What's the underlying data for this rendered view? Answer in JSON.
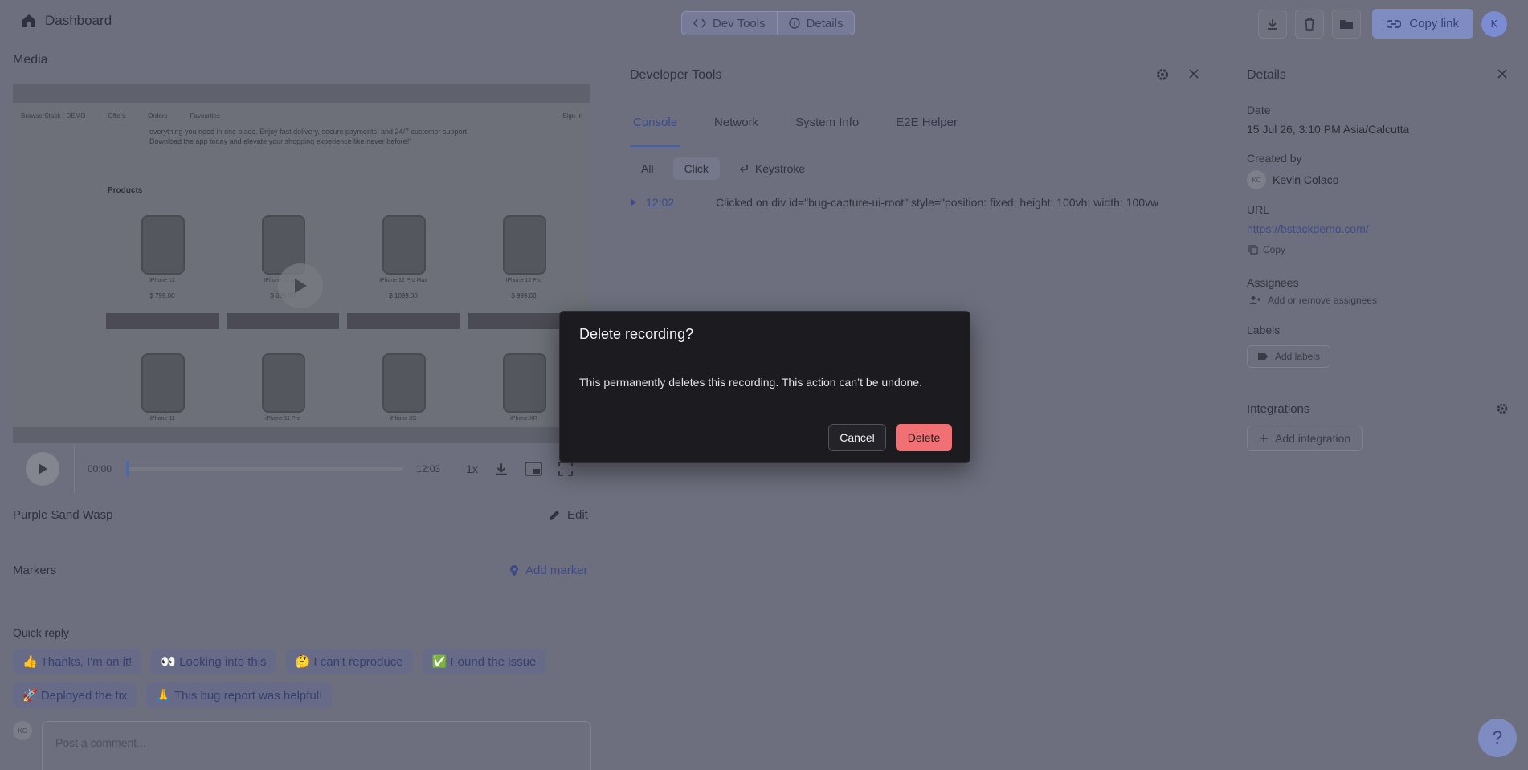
{
  "topbar": {
    "dashboard_label": "Dashboard",
    "tabs": [
      {
        "label": "Dev Tools"
      },
      {
        "label": "Details"
      }
    ],
    "copy_link_label": "Copy link",
    "avatar_initial": "K"
  },
  "media": {
    "title": "Media",
    "site": {
      "brand": "BrowserStack · DEMO",
      "nav": [
        "Offers",
        "Orders",
        "Favourites"
      ],
      "sign_in": "Sign In",
      "description": "everything you need in one place. Enjoy fast delivery, secure payments, and 24/7 customer support. Download the app today and elevate your shopping experience like never before!\"",
      "products_heading": "Products",
      "phones": [
        {
          "name": "iPhone 12",
          "price": "$ 799.00"
        },
        {
          "name": "iPhone 12 Mini",
          "price": "$ 699.00"
        },
        {
          "name": "iPhone 12 Pro Max",
          "price": "$ 1099.00"
        },
        {
          "name": "iPhone 12 Pro",
          "price": "$ 999.00"
        },
        {
          "name": "iPhone 11",
          "price": ""
        },
        {
          "name": "iPhone 11 Pro",
          "price": ""
        },
        {
          "name": "iPhone XS",
          "price": ""
        },
        {
          "name": "iPhone XR",
          "price": ""
        }
      ]
    },
    "controls": {
      "current_time": "00:00",
      "duration": "12:03",
      "speed": "1x",
      "progress": 0
    },
    "recording_name": "Purple Sand Wasp",
    "edit_label": "Edit",
    "markers_label": "Markers",
    "add_marker_label": "Add marker",
    "quick_reply_title": "Quick reply",
    "quick_replies": [
      "👍 Thanks, I'm on it!",
      "👀 Looking into this",
      "🤔 I can't reproduce",
      "✅ Found the issue",
      "🚀 Deployed the fix",
      "🙏 This bug report was helpful!"
    ],
    "comment_avatar": "KC",
    "comment_placeholder": "Post a comment..."
  },
  "devtools": {
    "title": "Developer Tools",
    "tabs": [
      "Console",
      "Network",
      "System Info",
      "E2E Helper"
    ],
    "active_tab": "Console",
    "filters": [
      "All",
      "Click",
      "Keystroke"
    ],
    "log": {
      "time": "12:02",
      "message": "Clicked on  div id=\"bug-capture-ui-root\" style=\"position: fixed; height: 100vh; width: 100vw"
    }
  },
  "details": {
    "title": "Details",
    "date_label": "Date",
    "date_value": "15 Jul 26, 3:10 PM Asia/Calcutta",
    "created_by_label": "Created by",
    "creator_initials": "KC",
    "creator_name": "Kevin Colaco",
    "url_label": "URL",
    "url_value": "https://bstackdemo.com/",
    "copy_label": "Copy",
    "assignees_label": "Assignees",
    "assignees_action": "Add or remove assignees",
    "labels_label": "Labels",
    "add_labels": "Add labels",
    "integrations_label": "Integrations",
    "add_integration": "Add integration"
  },
  "help_label": "?",
  "dialog": {
    "title": "Delete recording?",
    "message": "This permanently deletes this recording. This action can’t be undone.",
    "cancel_label": "Cancel",
    "delete_label": "Delete"
  },
  "colors": {
    "overlay_bg": "#6d6f7e",
    "dialog_bg": "#1c1c20",
    "danger": "#f07074",
    "accent": "#3c4b8c"
  },
  "icons": [
    "home-icon",
    "code-icon",
    "info-icon",
    "download-icon",
    "trash-icon",
    "folder-icon",
    "link-icon",
    "play-icon",
    "pip-icon",
    "fullscreen-icon",
    "pencil-icon",
    "pin-icon",
    "gear-icon",
    "close-icon",
    "copy-icon",
    "user-add-icon",
    "tag-icon",
    "plus-icon",
    "enter-icon",
    "caret-right-icon"
  ]
}
